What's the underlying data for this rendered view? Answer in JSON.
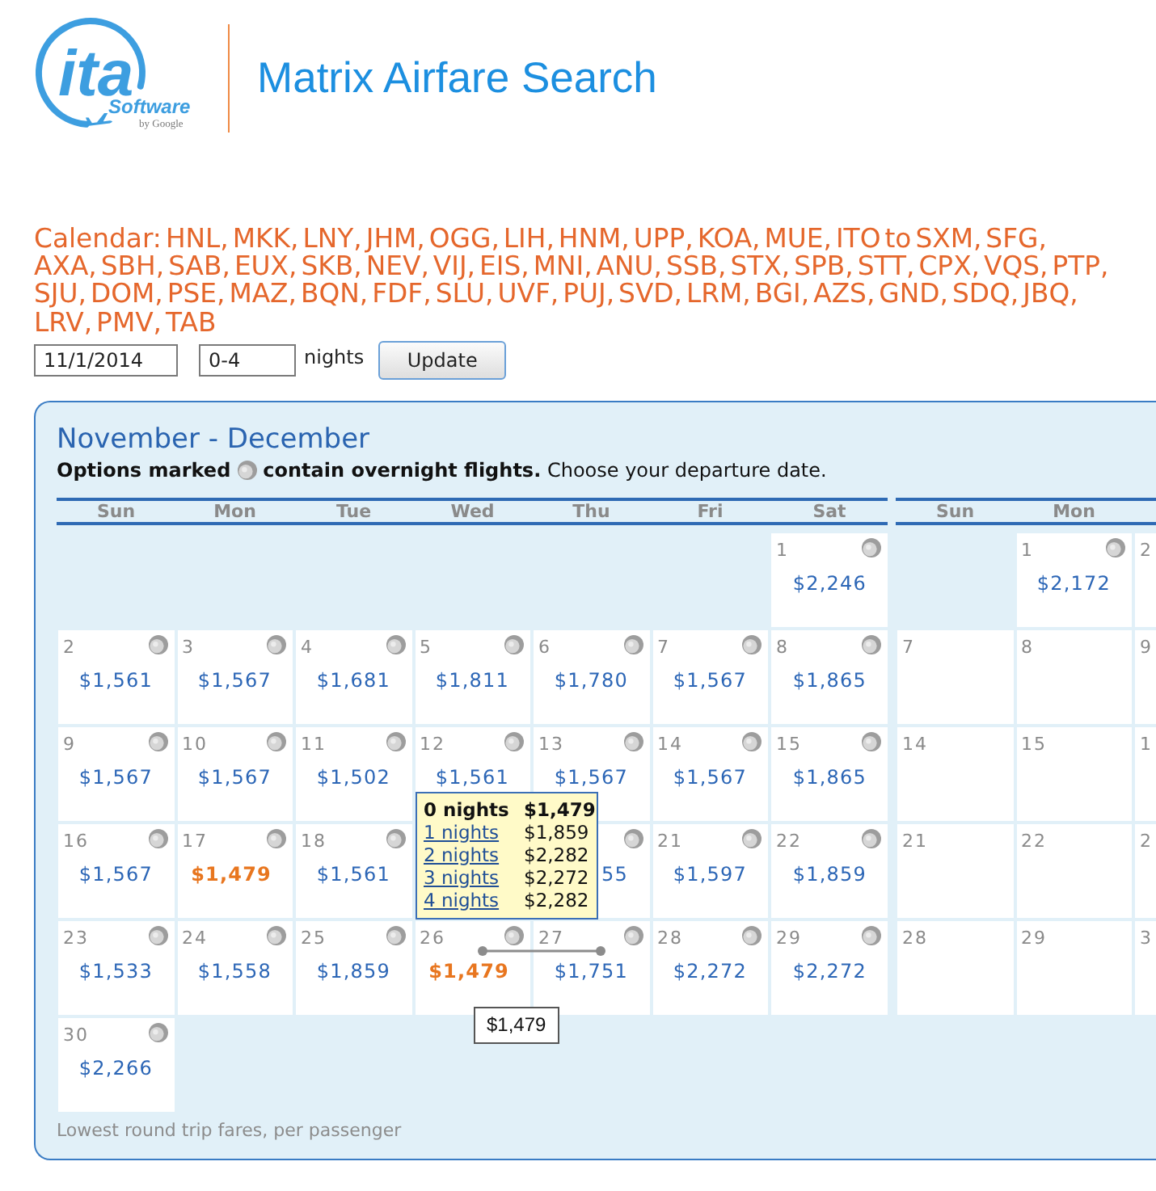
{
  "logo": {
    "wordmark": "ita",
    "subtitle": "Software",
    "byline": "by Google"
  },
  "title": "Matrix Airfare Search",
  "search": {
    "heading": "Calendar: HNL, MKK, LNY, JHM, OGG, LIH, HNM, UPP, KOA, MUE, ITO to SXM, SFG, AXA, SBH, SAB, EUX, SKB, NEV, VIJ, EIS, MNI, ANU, SSB, STX, SPB, STT, CPX, VQS, PTP, SJU, DOM, PSE, MAZ, BQN, FDF, SLU, UVF, PUJ, SVD, LRM, BGI, AZS, GND, SDQ, JBQ, LRV, PMV, TAB",
    "date": "11/1/2014",
    "nights": "0-4",
    "nights_label": "nights",
    "button": "Update"
  },
  "calendar": {
    "title": "November - December",
    "legend_start": "Options marked",
    "legend_end": "**contain overnight flights.** Choose your departure date.",
    "months": [
      {
        "weekdays": [
          "Sun",
          "Mon",
          "Tue",
          "Wed",
          "Thu",
          "Fri",
          "Sat"
        ],
        "weeks": [
          [
            {
              "kind": "empty"
            },
            {
              "kind": "empty"
            },
            {
              "kind": "empty"
            },
            {
              "kind": "empty"
            },
            {
              "kind": "empty"
            },
            {
              "kind": "empty"
            },
            {
              "kind": "day",
              "day": "1",
              "price": "$2,246",
              "overnight": true,
              "lowest": false
            }
          ],
          [
            {
              "kind": "day",
              "day": "2",
              "price": "$1,561",
              "overnight": true,
              "lowest": false
            },
            {
              "kind": "day",
              "day": "3",
              "price": "$1,567",
              "overnight": true,
              "lowest": false
            },
            {
              "kind": "day",
              "day": "4",
              "price": "$1,681",
              "overnight": true,
              "lowest": false
            },
            {
              "kind": "day",
              "day": "5",
              "price": "$1,811",
              "overnight": true,
              "lowest": false
            },
            {
              "kind": "day",
              "day": "6",
              "price": "$1,780",
              "overnight": true,
              "lowest": false
            },
            {
              "kind": "day",
              "day": "7",
              "price": "$1,567",
              "overnight": true,
              "lowest": false
            },
            {
              "kind": "day",
              "day": "8",
              "price": "$1,865",
              "overnight": true,
              "lowest": false
            }
          ],
          [
            {
              "kind": "day",
              "day": "9",
              "price": "$1,567",
              "overnight": true,
              "lowest": false
            },
            {
              "kind": "day",
              "day": "10",
              "price": "$1,567",
              "overnight": true,
              "lowest": false
            },
            {
              "kind": "day",
              "day": "11",
              "price": "$1,502",
              "overnight": true,
              "lowest": false
            },
            {
              "kind": "day",
              "day": "12",
              "price": "$1,561",
              "overnight": true,
              "lowest": false
            },
            {
              "kind": "day",
              "day": "13",
              "price": "$1,567",
              "overnight": true,
              "lowest": false
            },
            {
              "kind": "day",
              "day": "14",
              "price": "$1,567",
              "overnight": true,
              "lowest": false
            },
            {
              "kind": "day",
              "day": "15",
              "price": "$1,865",
              "overnight": true,
              "lowest": false
            }
          ],
          [
            {
              "kind": "day",
              "day": "16",
              "price": "$1,567",
              "overnight": true,
              "lowest": false
            },
            {
              "kind": "day",
              "day": "17",
              "price": "$1,479",
              "overnight": true,
              "lowest": true
            },
            {
              "kind": "day",
              "day": "18",
              "price": "$1,561",
              "overnight": true,
              "lowest": false
            },
            {
              "kind": "empty"
            },
            {
              "kind": "day",
              "price": "55",
              "overnight": true,
              "lowest": false
            },
            {
              "kind": "day",
              "day": "21",
              "price": "$1,597",
              "overnight": true,
              "lowest": false
            },
            {
              "kind": "day",
              "day": "22",
              "price": "$1,859",
              "overnight": true,
              "lowest": false
            }
          ],
          [
            {
              "kind": "day",
              "day": "23",
              "price": "$1,533",
              "overnight": true,
              "lowest": false
            },
            {
              "kind": "day",
              "day": "24",
              "price": "$1,558",
              "overnight": true,
              "lowest": false
            },
            {
              "kind": "day",
              "day": "25",
              "price": "$1,859",
              "overnight": true,
              "lowest": false
            },
            {
              "kind": "day",
              "day": "26",
              "price": "$1,479",
              "overnight": true,
              "lowest": true
            },
            {
              "kind": "day",
              "day": "27",
              "price": "$1,751",
              "overnight": true,
              "lowest": false
            },
            {
              "kind": "day",
              "day": "28",
              "price": "$2,272",
              "overnight": true,
              "lowest": false
            },
            {
              "kind": "day",
              "day": "29",
              "price": "$2,272",
              "overnight": true,
              "lowest": false
            }
          ],
          [
            {
              "kind": "day",
              "day": "30",
              "price": "$2,266",
              "overnight": true,
              "lowest": false
            },
            {
              "kind": "empty"
            },
            {
              "kind": "empty"
            },
            {
              "kind": "empty"
            },
            {
              "kind": "empty"
            },
            {
              "kind": "empty"
            },
            {
              "kind": "empty"
            }
          ]
        ]
      },
      {
        "weekdays": [
          "Sun",
          "Mon"
        ],
        "weeks": [
          [
            {
              "kind": "empty"
            },
            {
              "kind": "day",
              "day": "1",
              "price": "$2,172",
              "overnight": true,
              "lowest": false
            },
            {
              "kind": "day",
              "day": "2",
              "overnight": false
            }
          ],
          [
            {
              "kind": "day",
              "day": "7",
              "overnight": false
            },
            {
              "kind": "day",
              "day": "8",
              "overnight": false
            },
            {
              "kind": "day",
              "day": "9",
              "overnight": false
            }
          ],
          [
            {
              "kind": "day",
              "day": "14",
              "overnight": false
            },
            {
              "kind": "day",
              "day": "15",
              "overnight": false
            },
            {
              "kind": "day",
              "day": "1",
              "overnight": false
            }
          ],
          [
            {
              "kind": "day",
              "day": "21",
              "overnight": false
            },
            {
              "kind": "day",
              "day": "22",
              "overnight": false
            },
            {
              "kind": "day",
              "day": "2",
              "overnight": false
            }
          ],
          [
            {
              "kind": "day",
              "day": "28",
              "overnight": false
            },
            {
              "kind": "day",
              "day": "29",
              "overnight": false
            },
            {
              "kind": "day",
              "day": "3",
              "overnight": false
            }
          ],
          [
            {
              "kind": "empty"
            },
            {
              "kind": "empty"
            },
            {
              "kind": "empty"
            }
          ]
        ]
      }
    ],
    "hover": {
      "options": [
        {
          "nights": "0 nights",
          "price": "$1,479",
          "selected": true
        },
        {
          "nights": "1 nights",
          "price": "$1,859",
          "selected": false
        },
        {
          "nights": "2 nights",
          "price": "$2,282",
          "selected": false
        },
        {
          "nights": "3 nights",
          "price": "$2,272",
          "selected": false
        },
        {
          "nights": "4 nights",
          "price": "$2,282",
          "selected": false
        }
      ],
      "price_tip": "$1,479"
    },
    "footnote": "Lowest round trip fares, per passenger"
  }
}
